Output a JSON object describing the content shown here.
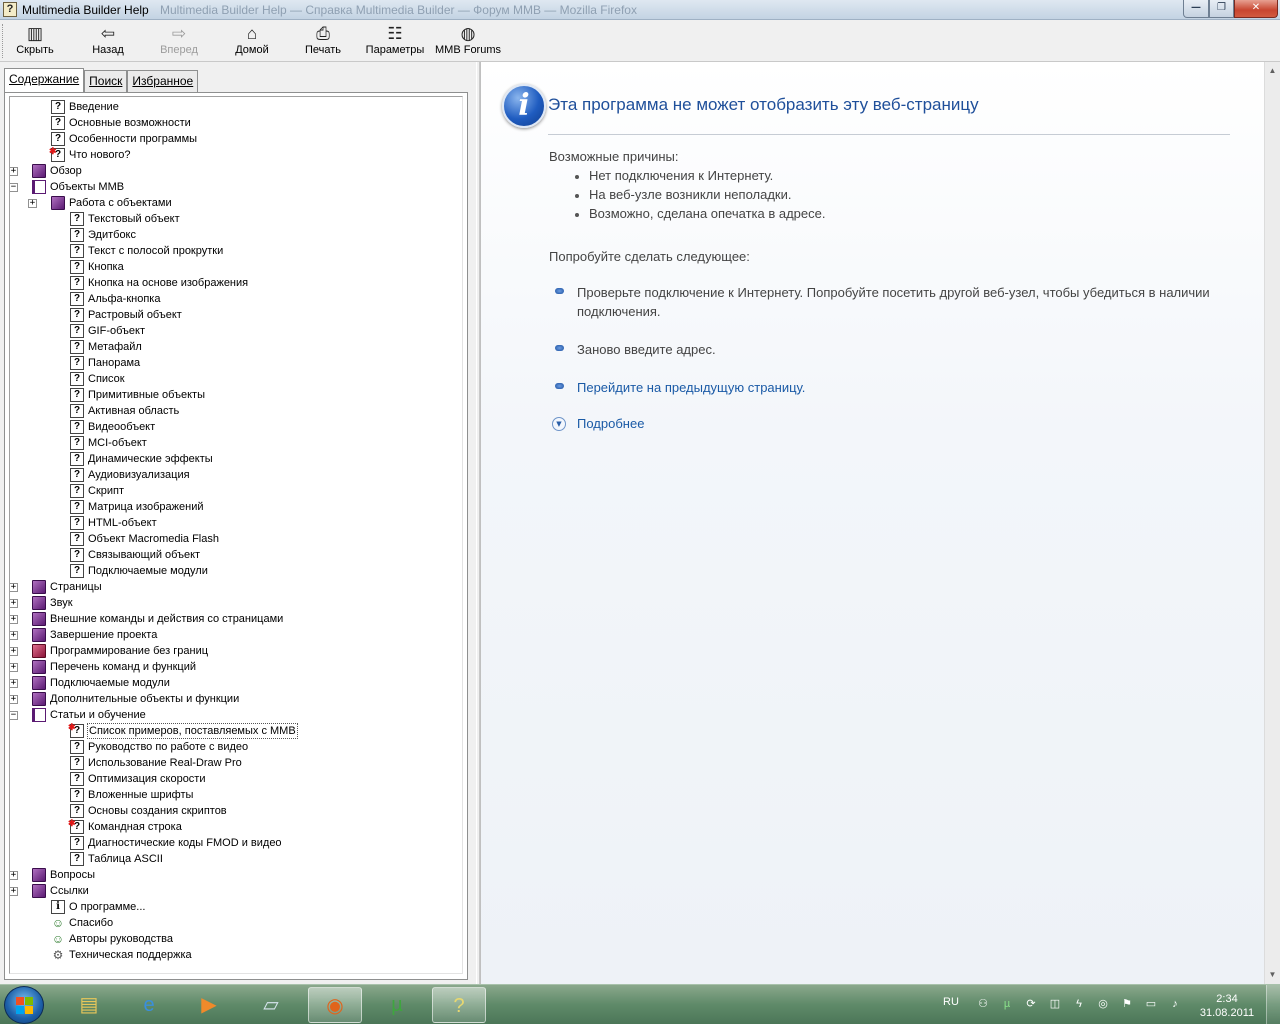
{
  "window": {
    "title": "Multimedia Builder Help",
    "background_title": "Multimedia Builder Help — Справка Multimedia Builder — Форум MMB — Mozilla Firefox",
    "controls": {
      "minimize": "—",
      "maximize": "❐",
      "close": "✕"
    }
  },
  "toolbar": {
    "buttons": [
      {
        "label": "Скрыть",
        "icon": "hide-pane-icon",
        "glyph": "▥",
        "enabled": true
      },
      {
        "label": "Назад",
        "icon": "back-arrow-icon",
        "glyph": "⇦",
        "enabled": true
      },
      {
        "label": "Вперед",
        "icon": "forward-arrow-icon",
        "glyph": "⇨",
        "enabled": false
      },
      {
        "label": "Домой",
        "icon": "home-icon",
        "glyph": "⌂",
        "enabled": true
      },
      {
        "label": "Печать",
        "icon": "printer-icon",
        "glyph": "⎙",
        "enabled": true
      },
      {
        "label": "Параметры",
        "icon": "options-icon",
        "glyph": "☷",
        "enabled": true
      },
      {
        "label": "MMB Forums",
        "icon": "globe-icon",
        "glyph": "◍",
        "enabled": true
      }
    ]
  },
  "tabs": [
    {
      "label": "Содержание",
      "active": true
    },
    {
      "label": "Поиск",
      "active": false
    },
    {
      "label": "Избранное",
      "active": false
    }
  ],
  "tree": [
    {
      "label": "Введение",
      "level": 1,
      "icon": "page"
    },
    {
      "label": "Основные возможности",
      "level": 1,
      "icon": "page"
    },
    {
      "label": "Особенности программы",
      "level": 1,
      "icon": "page"
    },
    {
      "label": "Что нового?",
      "level": 1,
      "icon": "page-new"
    },
    {
      "label": "Обзор",
      "level": 0,
      "icon": "book",
      "expander": "+"
    },
    {
      "label": "Объекты MMB",
      "level": 0,
      "icon": "book-open",
      "expander": "−"
    },
    {
      "label": "Работа с объектами",
      "level": 1,
      "icon": "book",
      "expander": "+"
    },
    {
      "label": "Текстовый объект",
      "level": 2,
      "icon": "page"
    },
    {
      "label": "Эдитбокс",
      "level": 2,
      "icon": "page"
    },
    {
      "label": "Текст с полосой прокрутки",
      "level": 2,
      "icon": "page"
    },
    {
      "label": "Кнопка",
      "level": 2,
      "icon": "page"
    },
    {
      "label": "Кнопка на основе изображения",
      "level": 2,
      "icon": "page"
    },
    {
      "label": "Альфа-кнопка",
      "level": 2,
      "icon": "page"
    },
    {
      "label": "Растровый объект",
      "level": 2,
      "icon": "page"
    },
    {
      "label": "GIF-объект",
      "level": 2,
      "icon": "page"
    },
    {
      "label": "Метафайл",
      "level": 2,
      "icon": "page"
    },
    {
      "label": "Панорама",
      "level": 2,
      "icon": "page"
    },
    {
      "label": "Список",
      "level": 2,
      "icon": "page"
    },
    {
      "label": "Примитивные объекты",
      "level": 2,
      "icon": "page"
    },
    {
      "label": "Активная область",
      "level": 2,
      "icon": "page"
    },
    {
      "label": "Видеообъект",
      "level": 2,
      "icon": "page"
    },
    {
      "label": "MCI-объект",
      "level": 2,
      "icon": "page"
    },
    {
      "label": "Динамические эффекты",
      "level": 2,
      "icon": "page"
    },
    {
      "label": "Аудиовизуализация",
      "level": 2,
      "icon": "page"
    },
    {
      "label": "Скрипт",
      "level": 2,
      "icon": "page"
    },
    {
      "label": "Матрица изображений",
      "level": 2,
      "icon": "page"
    },
    {
      "label": "HTML-объект",
      "level": 2,
      "icon": "page"
    },
    {
      "label": "Объект Macromedia Flash",
      "level": 2,
      "icon": "page"
    },
    {
      "label": "Связывающий объект",
      "level": 2,
      "icon": "page"
    },
    {
      "label": "Подключаемые модули",
      "level": 2,
      "icon": "page"
    },
    {
      "label": "Страницы",
      "level": 0,
      "icon": "book",
      "expander": "+"
    },
    {
      "label": "Звук",
      "level": 0,
      "icon": "book",
      "expander": "+"
    },
    {
      "label": "Внешние команды и действия со страницами",
      "level": 0,
      "icon": "book",
      "expander": "+"
    },
    {
      "label": "Завершение проекта",
      "level": 0,
      "icon": "book",
      "expander": "+"
    },
    {
      "label": "Программирование без границ",
      "level": 0,
      "icon": "book-red",
      "expander": "+"
    },
    {
      "label": "Перечень команд и функций",
      "level": 0,
      "icon": "book",
      "expander": "+"
    },
    {
      "label": "Подключаемые модули",
      "level": 0,
      "icon": "book",
      "expander": "+"
    },
    {
      "label": "Дополнительные объекты и функции",
      "level": 0,
      "icon": "book",
      "expander": "+"
    },
    {
      "label": "Статьи и обучение",
      "level": 0,
      "icon": "book-open",
      "expander": "−"
    },
    {
      "label": "Список примеров, поставляемых с MMB",
      "level": 2,
      "icon": "page-new",
      "selected": true
    },
    {
      "label": "Руководство по работе с видео",
      "level": 2,
      "icon": "page"
    },
    {
      "label": "Использование Real-Draw Pro",
      "level": 2,
      "icon": "page"
    },
    {
      "label": "Оптимизация скорости",
      "level": 2,
      "icon": "page"
    },
    {
      "label": "Вложенные шрифты",
      "level": 2,
      "icon": "page"
    },
    {
      "label": "Основы создания скриптов",
      "level": 2,
      "icon": "page"
    },
    {
      "label": "Командная строка",
      "level": 2,
      "icon": "page-new"
    },
    {
      "label": "Диагностические коды FMOD и видео",
      "level": 2,
      "icon": "page"
    },
    {
      "label": "Таблица ASCII",
      "level": 2,
      "icon": "page"
    },
    {
      "label": "Вопросы",
      "level": 0,
      "icon": "book",
      "expander": "+"
    },
    {
      "label": "Ссылки",
      "level": 0,
      "icon": "book",
      "expander": "+"
    },
    {
      "label": "О программе...",
      "level": 1,
      "icon": "info"
    },
    {
      "label": "Спасибо",
      "level": 1,
      "icon": "people"
    },
    {
      "label": "Авторы руководства",
      "level": 1,
      "icon": "people"
    },
    {
      "label": "Техническая поддержка",
      "level": 1,
      "icon": "gear"
    }
  ],
  "error_page": {
    "title": "Эта программа не может отобразить эту веб-страницу",
    "reasons_heading": "Возможные причины:",
    "reasons": [
      "Нет подключения к Интернету.",
      "На веб-узле возникли неполадки.",
      "Возможно, сделана опечатка в адресе."
    ],
    "try_heading": "Попробуйте сделать следующее:",
    "tips": [
      {
        "text": "Проверьте подключение к Интернету. Попробуйте посетить другой веб-узел, чтобы убедиться в наличии подключения.",
        "link": false
      },
      {
        "text": "Заново введите адрес.",
        "link": false
      },
      {
        "text": "Перейдите на предыдущую страницу.",
        "link": true
      }
    ],
    "more_label": "Подробнее"
  },
  "taskbar": {
    "apps": [
      {
        "name": "explorer",
        "glyph": "▤",
        "color": "#e8c75a",
        "active": false
      },
      {
        "name": "internet-explorer",
        "glyph": "e",
        "color": "#3a8fdc",
        "active": false
      },
      {
        "name": "media-player",
        "glyph": "▶",
        "color": "#f08a2a",
        "active": false
      },
      {
        "name": "notes",
        "glyph": "▱",
        "color": "#d9e6ef",
        "active": false
      },
      {
        "name": "firefox",
        "glyph": "◉",
        "color": "#e0641c",
        "active": true
      },
      {
        "name": "utorrent",
        "glyph": "µ",
        "color": "#3fa53f",
        "active": false
      },
      {
        "name": "help",
        "glyph": "?",
        "color": "#e8d870",
        "active": true
      }
    ],
    "language": "RU",
    "time": "2:34",
    "date": "31.08.2011"
  }
}
